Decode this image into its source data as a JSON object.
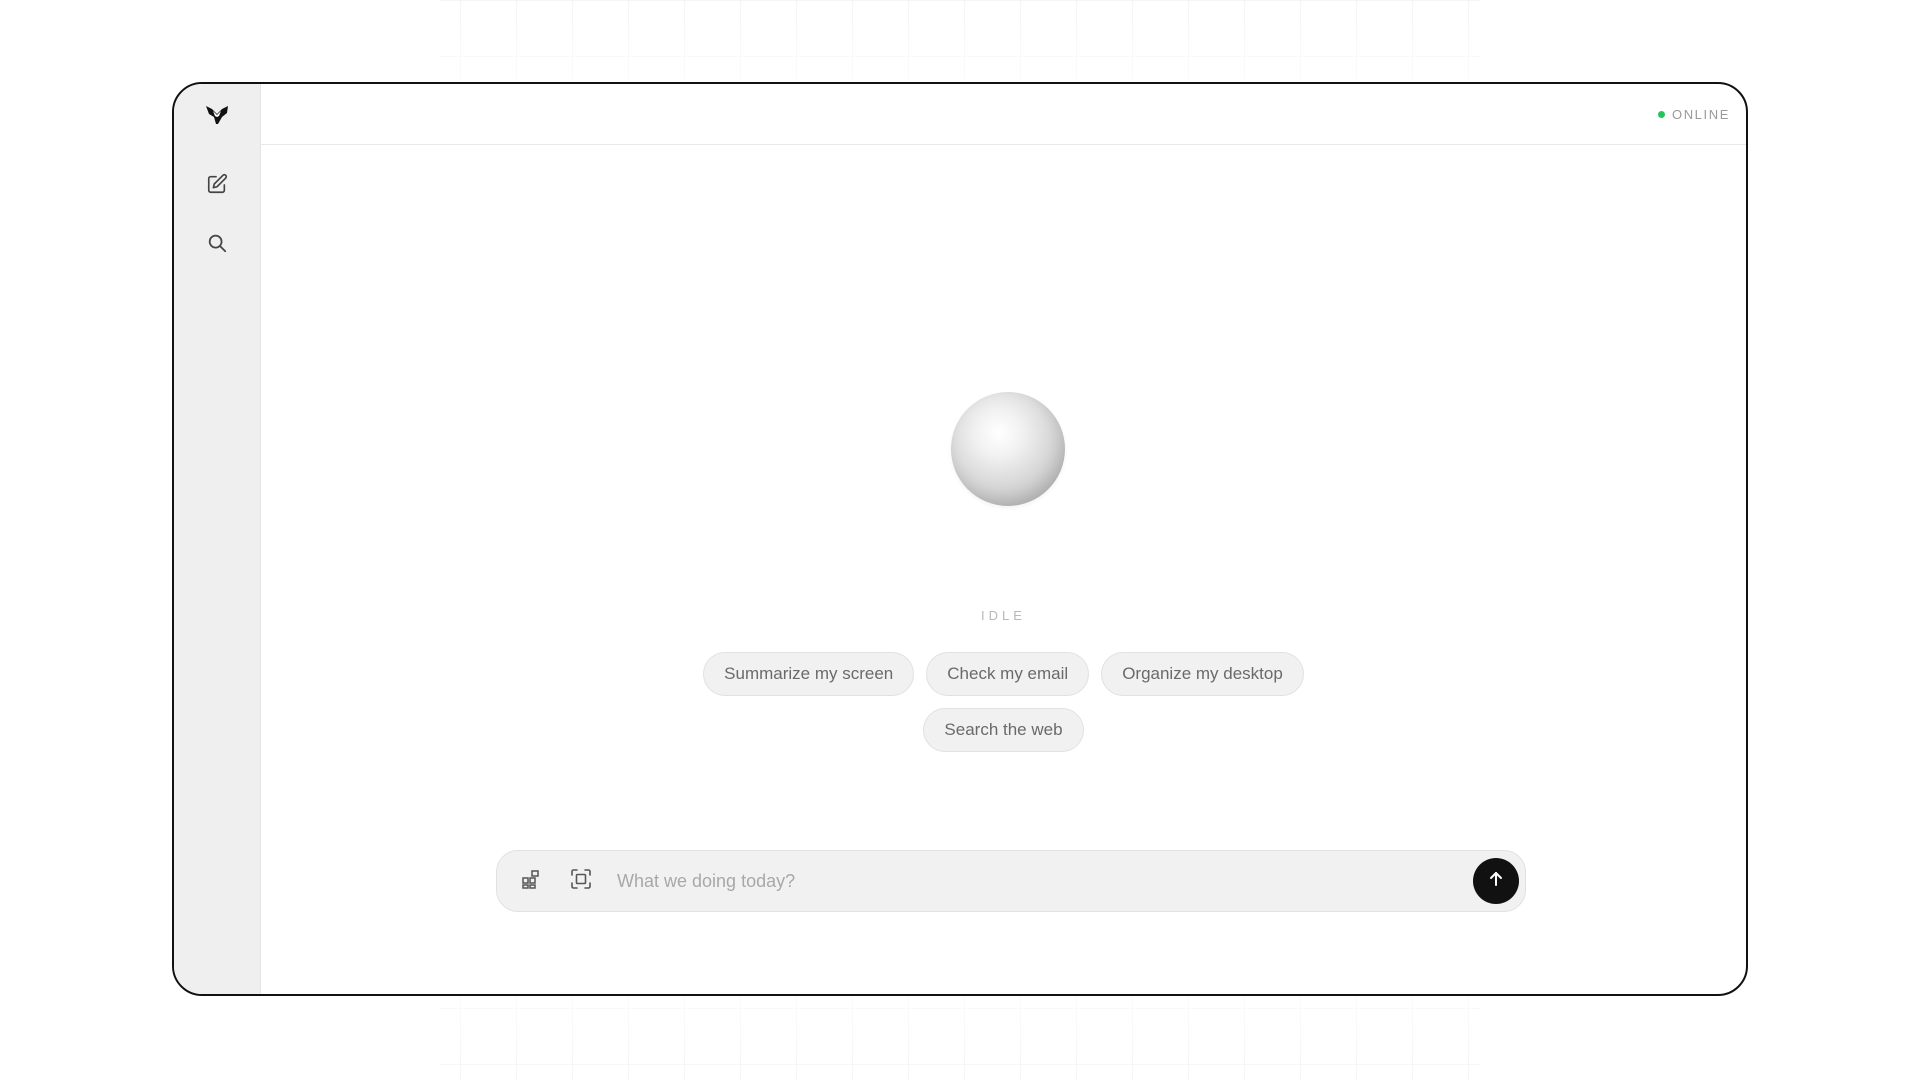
{
  "app": {
    "logo_icon": "fox-head-logo-icon"
  },
  "sidebar": {
    "items": [
      {
        "icon": "edit-icon",
        "action": "new-chat"
      },
      {
        "icon": "search-icon",
        "action": "search"
      }
    ]
  },
  "header": {
    "status_text": "ONLINE",
    "status_color": "#22c55e"
  },
  "assistant": {
    "state_label": "IDLE"
  },
  "suggestions": [
    {
      "label": "Summarize my screen"
    },
    {
      "label": "Check my email"
    },
    {
      "label": "Organize my desktop"
    },
    {
      "label": "Search the web"
    }
  ],
  "composer": {
    "placeholder": "What we doing today?",
    "value": "",
    "left_icons": [
      "apps-add-icon",
      "screen-capture-icon"
    ],
    "send_icon": "arrow-up-icon"
  },
  "colors": {
    "send_button": "#111111",
    "sidebar_bg": "#efefef",
    "chip_bg": "#f1f1f1"
  }
}
